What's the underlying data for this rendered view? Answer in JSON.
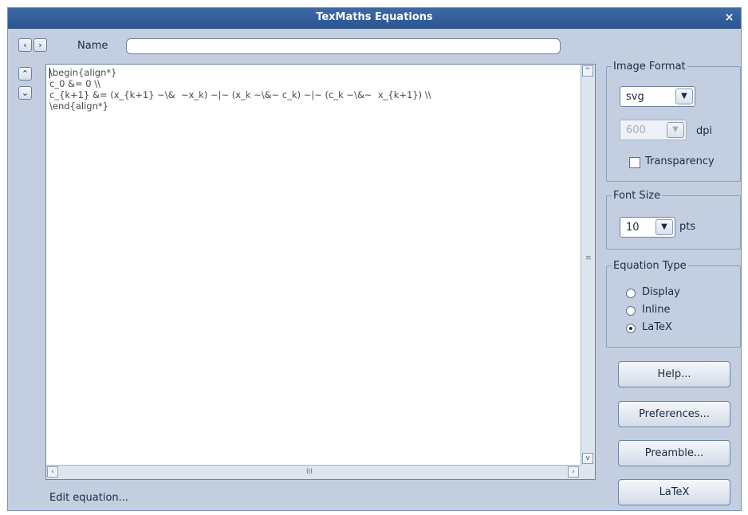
{
  "window": {
    "title": "TexMaths Equations",
    "close_icon": "×"
  },
  "nav": {
    "prev_icon": "‹",
    "next_icon": "›",
    "up_icon": "⌃",
    "down_icon": "⌄"
  },
  "name_field": {
    "label": "Name",
    "value": ""
  },
  "editor": {
    "text": "\\begin{align*}\nc_0 &= 0 \\\\\nc_{k+1} &= (x_{k+1} ~\\&  ~x_k) ~|~ (x_k ~\\&~ c_k) ~|~ (c_k ~\\&~  x_{k+1}) \\\\\n\\end{align*}",
    "scroll_grip": "≡",
    "hscroll_grip": "III",
    "scroll_left": "‹",
    "scroll_right": "›",
    "scroll_up": "^",
    "scroll_down": "v"
  },
  "image_format": {
    "legend": "Image Format",
    "format_value": "svg",
    "dpi_value": "600",
    "dpi_label": "dpi",
    "transparency_label": "Transparency",
    "transparency_checked": false
  },
  "font_size": {
    "legend": "Font Size",
    "value": "10",
    "unit": "pts"
  },
  "equation_type": {
    "legend": "Equation Type",
    "options": [
      {
        "label": "Display",
        "selected": false
      },
      {
        "label": "Inline",
        "selected": false
      },
      {
        "label": "LaTeX",
        "selected": true
      }
    ]
  },
  "buttons": {
    "help": "Help...",
    "preferences": "Preferences...",
    "preamble": "Preamble...",
    "latex": "LaTeX"
  },
  "status": "Edit equation...",
  "colors": {
    "titlebar": "#2f5b96",
    "window_bg": "#c3cfe0"
  }
}
